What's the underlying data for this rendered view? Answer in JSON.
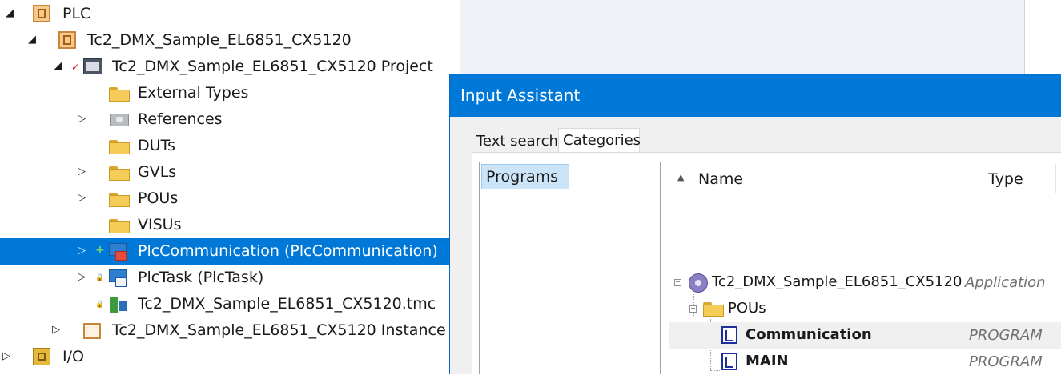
{
  "tree": {
    "items": [
      {
        "label": "PLC",
        "expander": "◢",
        "icon": "plc-icon"
      },
      {
        "label": "Tc2_DMX_Sample_EL6851_CX5120",
        "expander": "◢",
        "icon": "plc-project-icon"
      },
      {
        "label": "Tc2_DMX_Sample_EL6851_CX5120 Project",
        "expander": "◢",
        "marker": "✓",
        "icon": "project-icon"
      },
      {
        "label": "External Types",
        "icon": "folder-icon"
      },
      {
        "label": "References",
        "expander": "▷",
        "icon": "references-icon"
      },
      {
        "label": "DUTs",
        "icon": "folder-icon"
      },
      {
        "label": "GVLs",
        "expander": "▷",
        "icon": "folder-icon"
      },
      {
        "label": "POUs",
        "expander": "▷",
        "icon": "folder-icon"
      },
      {
        "label": "VISUs",
        "icon": "folder-icon"
      },
      {
        "label": "PlcCommunication (PlcCommunication)",
        "expander": "▷",
        "marker": "+",
        "icon": "task-icon",
        "selected": true
      },
      {
        "label": "PlcTask (PlcTask)",
        "expander": "▷",
        "marker": "🔒",
        "icon": "task-icon"
      },
      {
        "label": "Tc2_DMX_Sample_EL6851_CX5120.tmc",
        "marker": "🔒",
        "icon": "tmc-icon"
      },
      {
        "label": "Tc2_DMX_Sample_EL6851_CX5120 Instance",
        "expander": "▷",
        "icon": "instance-icon"
      },
      {
        "label": "I/O",
        "expander": "▷",
        "icon": "io-icon"
      }
    ]
  },
  "dialog": {
    "title": "Input Assistant",
    "tabs": [
      {
        "label": "Text search",
        "active": false
      },
      {
        "label": "Categories",
        "active": true
      }
    ],
    "categories": [
      "Programs"
    ],
    "columns": {
      "name": "Name",
      "type": "Type"
    },
    "items": [
      {
        "name": "Tc2_DMX_Sample_EL6851_CX5120",
        "type": "Application",
        "icon": "application-gear-icon"
      },
      {
        "name": "POUs",
        "type": "",
        "icon": "folder-icon"
      },
      {
        "name": "Communication",
        "type": "PROGRAM",
        "icon": "program-icon",
        "bold": true
      },
      {
        "name": "MAIN",
        "type": "PROGRAM",
        "icon": "program-icon",
        "bold": true
      }
    ]
  },
  "colors": {
    "selection": "#0078d7",
    "title_bar": "#0078d7",
    "category_highlight": "#cce4f7"
  }
}
